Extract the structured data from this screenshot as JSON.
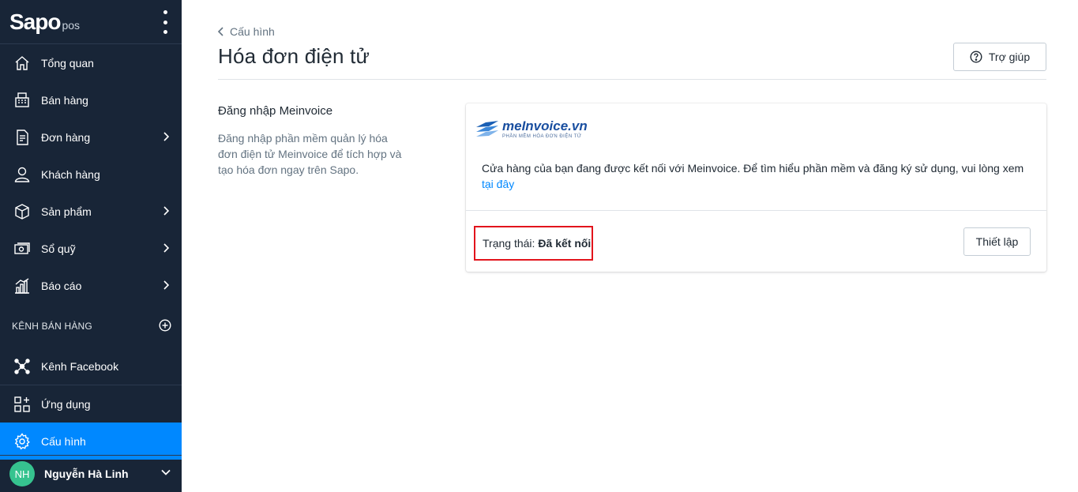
{
  "sidebar": {
    "logo_main": "Sapo",
    "logo_sub": "pos",
    "items": [
      {
        "label": "Tổng quan",
        "icon": "home-icon",
        "has_chevron": false
      },
      {
        "label": "Bán hàng",
        "icon": "cash-register-icon",
        "has_chevron": false
      },
      {
        "label": "Đơn hàng",
        "icon": "order-icon",
        "has_chevron": true
      },
      {
        "label": "Khách hàng",
        "icon": "user-icon",
        "has_chevron": false
      },
      {
        "label": "Sản phẩm",
        "icon": "box-icon",
        "has_chevron": true
      },
      {
        "label": "Sổ quỹ",
        "icon": "cash-book-icon",
        "has_chevron": true
      },
      {
        "label": "Báo cáo",
        "icon": "report-chart-icon",
        "has_chevron": true
      }
    ],
    "section_label": "KÊNH BÁN HÀNG",
    "channel_item": {
      "label": "Kênh Facebook",
      "icon": "network-icon"
    },
    "apps_item": {
      "label": "Ứng dụng",
      "icon": "apps-grid-icon"
    },
    "settings_item": {
      "label": "Cấu hình",
      "icon": "gear-icon"
    },
    "user": {
      "initials": "NH",
      "name": "Nguyễn Hà Linh"
    },
    "colors": {
      "background": "#182537",
      "active": "#0088ff",
      "avatar": "#36c38f"
    }
  },
  "header": {
    "back_label": "Cấu hình",
    "title": "Hóa đơn điện tử",
    "help_label": "Trợ giúp"
  },
  "section": {
    "title": "Đăng nhập Meinvoice",
    "description": "Đăng nhập phần mềm quản lý hóa đơn điện tử Meinvoice để tích hợp và tạo hóa đơn ngay trên Sapo."
  },
  "card": {
    "logo_name": "meInvoice.vn",
    "logo_tagline": "PHẦN MỀM HÓA ĐƠN ĐIỆN TỬ",
    "message": "Cửa hàng của bạn đang được kết nối với Meinvoice. Để tìm hiểu phần mềm và đăng ký sử dụng, vui lòng xem",
    "link_label": "tại đây",
    "status_label": "Trạng thái:",
    "status_value": "Đã kết nối",
    "setup_label": "Thiết lập",
    "colors": {
      "link": "#0088ff",
      "highlight": "#e2141c"
    }
  }
}
